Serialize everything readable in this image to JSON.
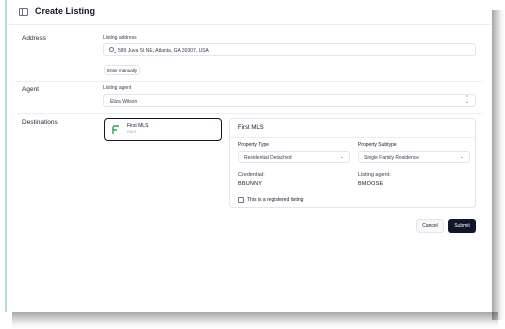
{
  "header": {
    "title": "Create Listing",
    "sidebar_toggle_icon": "sidebar-toggle-icon"
  },
  "address": {
    "section_label": "Address",
    "field_label": "Listing address",
    "value": "589 Juva St NE, Atlanta, GA 30307, USA",
    "icon": "search-icon",
    "enter_manually_label": "Enter manually"
  },
  "agent": {
    "section_label": "Agent",
    "field_label": "Listing agent",
    "value": "Eliza Wilson",
    "icon": "up-down-chevron-icon"
  },
  "destinations": {
    "section_label": "Destinations",
    "mls_card": {
      "name": "First MLS",
      "code": "FMLS",
      "logo_color": "#2e9e5b"
    },
    "panel": {
      "title": "First MLS",
      "property_type_label": "Property Type",
      "property_type_value": "Residential Detached",
      "property_subtype_label": "Property Subtype",
      "property_subtype_value": "Single Family Residence",
      "credential_label": "Credential:",
      "credential_value": "BBUNNY",
      "listing_agent_label": "Listing agent:",
      "listing_agent_value": "BMOOSE",
      "registered_label": "This is a registered listing",
      "registered_checked": false
    }
  },
  "actions": {
    "cancel_label": "Cancel",
    "submit_label": "Submit"
  },
  "colors": {
    "accent_border": "#b7dfcf",
    "primary_button": "#0f172a"
  }
}
